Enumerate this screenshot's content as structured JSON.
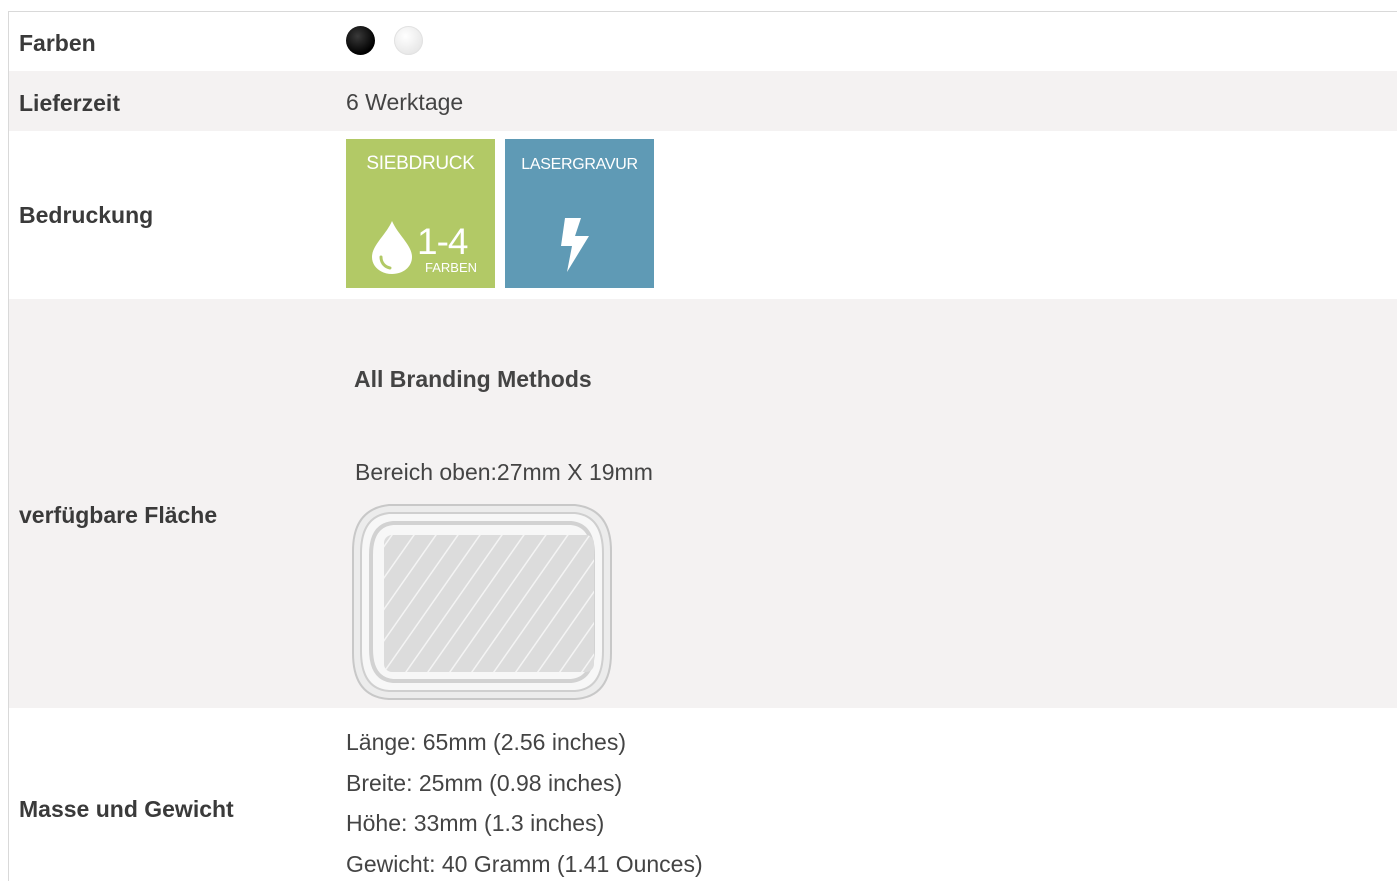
{
  "rows": {
    "farben": {
      "label": "Farben",
      "swatches": [
        {
          "name": "black",
          "color": "#000000"
        },
        {
          "name": "white",
          "color": "#ffffff"
        }
      ]
    },
    "lieferzeit": {
      "label": "Lieferzeit",
      "value": "6 Werktage"
    },
    "bedruckung": {
      "label": "Bedruckung",
      "methods": [
        {
          "title": "SIEBDRUCK",
          "range": "1-4",
          "unit": "FARBEN",
          "icon": "drop-icon",
          "color": "#b2c966"
        },
        {
          "title": "LASERGRAVUR",
          "icon": "lightning-icon",
          "color": "#5f9ab5"
        }
      ]
    },
    "flaeche": {
      "label": "verfügbare Fläche",
      "branding_title": "All Branding Methods",
      "area": "Bereich oben:27mm X 19mm"
    },
    "masse": {
      "label": "Masse und Gewicht",
      "laenge": "Länge: 65mm (2.56 inches)",
      "breite": "Breite: 25mm (0.98 inches)",
      "hoehe": "Höhe: 33mm (1.3 inches)",
      "gewicht": "Gewicht: 40 Gramm (1.41 Ounces)"
    }
  }
}
